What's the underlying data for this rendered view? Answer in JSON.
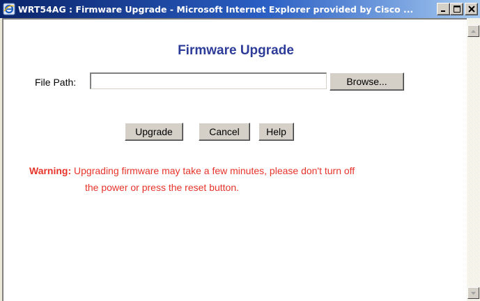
{
  "window": {
    "title": "WRT54AG : Firmware Upgrade - Microsoft Internet Explorer provided by Cisco ...",
    "controls": {
      "minimize": "minimize-icon",
      "maximize": "maximize-icon",
      "close": "close-icon"
    }
  },
  "page": {
    "title": "Firmware Upgrade",
    "file_path_label": "File Path:",
    "file_path_value": "",
    "browse_label": "Browse...",
    "upgrade_label": "Upgrade",
    "cancel_label": "Cancel",
    "help_label": "Help",
    "warning_label": "Warning:",
    "warning_line1": "Upgrading firmware may take a few minutes, please don't turn off",
    "warning_line2": "the power or press the reset button."
  },
  "colors": {
    "title_blue": "#2e3c99",
    "warning_red": "#e8332a",
    "titlebar_dark": "#0a246a"
  }
}
